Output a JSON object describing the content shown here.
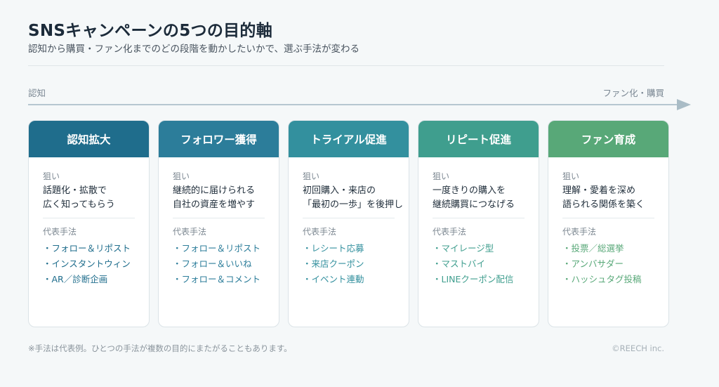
{
  "header": {
    "title": "SNSキャンペーンの5つの目的軸",
    "subtitle": "認知から購買・ファン化までのどの段階を動かしたいかで、選ぶ手法が変わる"
  },
  "axis": {
    "start_label": "認知",
    "end_label": "ファン化・購買"
  },
  "section_labels": {
    "aim": "狙い",
    "methods": "代表手法"
  },
  "colors": {
    "stage1": "#1f6d8c",
    "stage2": "#2c7d9a",
    "stage3": "#33909e",
    "stage4": "#3f9e8e",
    "stage5": "#58a878"
  },
  "stages": [
    {
      "title": "認知拡大",
      "aim_lines": [
        "話題化・拡散で",
        "広く知ってもらう"
      ],
      "methods": [
        "・フォロー＆リポスト",
        "・インスタントウィン",
        "・AR／診断企画"
      ]
    },
    {
      "title": "フォロワー獲得",
      "aim_lines": [
        "継続的に届けられる",
        "自社の資産を増やす"
      ],
      "methods": [
        "・フォロー＆リポスト",
        "・フォロー＆いいね",
        "・フォロー＆コメント"
      ]
    },
    {
      "title": "トライアル促進",
      "aim_lines": [
        "初回購入・来店の",
        "「最初の一歩」を後押し"
      ],
      "methods": [
        "・レシート応募",
        "・来店クーポン",
        "・イベント連動"
      ]
    },
    {
      "title": "リピート促進",
      "aim_lines": [
        "一度きりの購入を",
        "継続購買につなげる"
      ],
      "methods": [
        "・マイレージ型",
        "・マストバイ",
        "・LINEクーポン配信"
      ]
    },
    {
      "title": "ファン育成",
      "aim_lines": [
        "理解・愛着を深め",
        "語られる関係を築く"
      ],
      "methods": [
        "・投票／総選挙",
        "・アンバサダー",
        "・ハッシュタグ投稿"
      ]
    }
  ],
  "footer": {
    "note": "※手法は代表例。ひとつの手法が複数の目的にまたがることもあります。",
    "credit": "©REECH inc."
  }
}
